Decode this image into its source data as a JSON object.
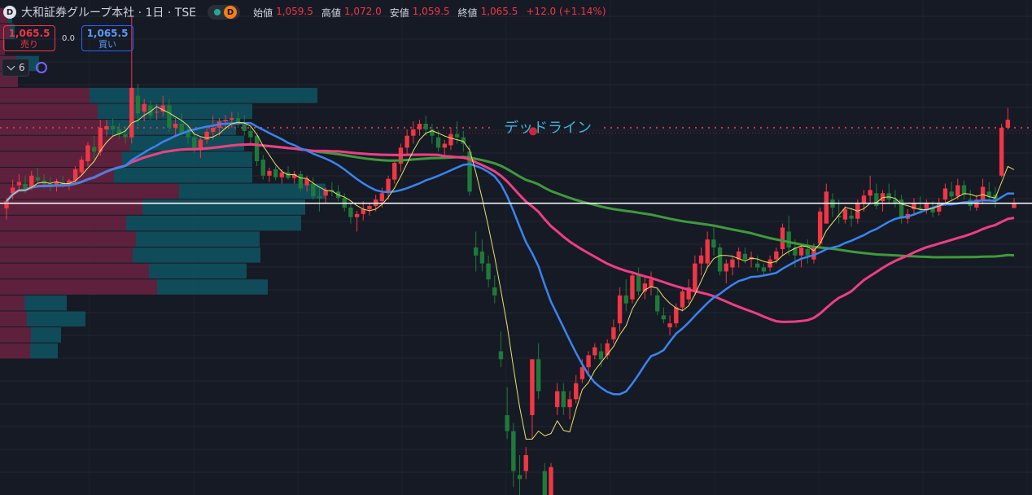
{
  "header": {
    "symbol_icon": "D",
    "title": "大和証券グループ本社 · 1日 · TSE",
    "data_badge": "D",
    "ohlc": {
      "open_label": "始値",
      "open": "1,059.5",
      "high_label": "高値",
      "high": "1,072.0",
      "low_label": "安値",
      "low": "1,059.5",
      "close_label": "終値",
      "close": "1,065.5",
      "change": "+12.0 (+1.14%)"
    }
  },
  "trade": {
    "sell_price": "1,065.5",
    "sell_label": "売り",
    "spread": "0.0",
    "buy_price": "1,065.5",
    "buy_label": "買い"
  },
  "indicators": {
    "count": "6",
    "toggle_icon": "chevron-down-icon",
    "sync_icon": "sync-icon"
  },
  "colors": {
    "background": "#161a25",
    "up": "#f23645",
    "down": "#1f7a3a",
    "ma_fast": "#e8e36a",
    "ma_mid": "#3a84f0",
    "ma_slow": "#ee3e84",
    "ma_long": "#3f9a3a",
    "vp_pink": "#6a2342",
    "vp_teal": "#0f5563",
    "price_line": "#ffffff"
  },
  "chart_data": {
    "type": "candlestick",
    "annotation": {
      "text": "デッドライン",
      "price": 1160
    },
    "ylim": [
      700,
      1320
    ],
    "current_price": 1065.5,
    "grid": true,
    "ohlc": [
      [
        1059,
        1072,
        1045,
        1068
      ],
      [
        1078,
        1095,
        1070,
        1085
      ],
      [
        1088,
        1102,
        1080,
        1092
      ],
      [
        1090,
        1100,
        1078,
        1082
      ],
      [
        1084,
        1106,
        1082,
        1100
      ],
      [
        1098,
        1110,
        1090,
        1094
      ],
      [
        1094,
        1102,
        1084,
        1090
      ],
      [
        1090,
        1098,
        1080,
        1086
      ],
      [
        1086,
        1096,
        1080,
        1092
      ],
      [
        1092,
        1100,
        1085,
        1088
      ],
      [
        1088,
        1096,
        1082,
        1094
      ],
      [
        1094,
        1112,
        1090,
        1108
      ],
      [
        1104,
        1124,
        1100,
        1120
      ],
      [
        1118,
        1142,
        1112,
        1138
      ],
      [
        1136,
        1150,
        1120,
        1130
      ],
      [
        1130,
        1170,
        1125,
        1160
      ],
      [
        1158,
        1170,
        1150,
        1162
      ],
      [
        1162,
        1172,
        1150,
        1158
      ],
      [
        1158,
        1166,
        1146,
        1152
      ],
      [
        1152,
        1162,
        1140,
        1148
      ],
      [
        1148,
        1300,
        1140,
        1210
      ],
      [
        1200,
        1215,
        1162,
        1178
      ],
      [
        1180,
        1196,
        1168,
        1190
      ],
      [
        1188,
        1194,
        1170,
        1175
      ],
      [
        1180,
        1190,
        1170,
        1180
      ],
      [
        1180,
        1200,
        1174,
        1188
      ],
      [
        1188,
        1196,
        1155,
        1160
      ],
      [
        1160,
        1172,
        1148,
        1165
      ],
      [
        1165,
        1178,
        1150,
        1152
      ],
      [
        1155,
        1162,
        1140,
        1148
      ],
      [
        1148,
        1158,
        1128,
        1135
      ],
      [
        1135,
        1148,
        1122,
        1145
      ],
      [
        1145,
        1162,
        1140,
        1155
      ],
      [
        1155,
        1175,
        1145,
        1160
      ],
      [
        1160,
        1172,
        1150,
        1168
      ],
      [
        1168,
        1176,
        1158,
        1170
      ],
      [
        1170,
        1180,
        1160,
        1172
      ],
      [
        1172,
        1180,
        1160,
        1164
      ],
      [
        1164,
        1176,
        1150,
        1156
      ],
      [
        1156,
        1164,
        1140,
        1148
      ],
      [
        1150,
        1152,
        1112,
        1118
      ],
      [
        1120,
        1126,
        1095,
        1100
      ],
      [
        1100,
        1110,
        1092,
        1106
      ],
      [
        1108,
        1112,
        1094,
        1098
      ],
      [
        1098,
        1108,
        1090,
        1104
      ],
      [
        1104,
        1112,
        1095,
        1097
      ],
      [
        1097,
        1106,
        1090,
        1102
      ],
      [
        1102,
        1106,
        1080,
        1084
      ],
      [
        1088,
        1100,
        1080,
        1096
      ],
      [
        1090,
        1098,
        1070,
        1074
      ],
      [
        1074,
        1084,
        1055,
        1072
      ],
      [
        1075,
        1085,
        1065,
        1082
      ],
      [
        1082,
        1092,
        1074,
        1080
      ],
      [
        1080,
        1088,
        1068,
        1072
      ],
      [
        1072,
        1078,
        1055,
        1060
      ],
      [
        1060,
        1065,
        1040,
        1048
      ],
      [
        1048,
        1056,
        1030,
        1052
      ],
      [
        1052,
        1068,
        1044,
        1058
      ],
      [
        1058,
        1066,
        1050,
        1062
      ],
      [
        1062,
        1076,
        1055,
        1070
      ],
      [
        1068,
        1085,
        1060,
        1078
      ],
      [
        1078,
        1100,
        1070,
        1096
      ],
      [
        1095,
        1120,
        1090,
        1116
      ],
      [
        1115,
        1140,
        1105,
        1135
      ],
      [
        1135,
        1158,
        1125,
        1150
      ],
      [
        1150,
        1168,
        1140,
        1158
      ],
      [
        1158,
        1170,
        1150,
        1165
      ],
      [
        1165,
        1175,
        1150,
        1158
      ],
      [
        1158,
        1165,
        1140,
        1150
      ],
      [
        1148,
        1156,
        1130,
        1135
      ],
      [
        1135,
        1145,
        1122,
        1140
      ],
      [
        1138,
        1160,
        1132,
        1152
      ],
      [
        1152,
        1168,
        1140,
        1148
      ],
      [
        1148,
        1156,
        1130,
        1140
      ],
      [
        1130,
        1138,
        1075,
        1080
      ],
      [
        1010,
        1030,
        980,
        1000
      ],
      [
        1005,
        1020,
        980,
        990
      ],
      [
        990,
        1000,
        960,
        970
      ],
      [
        960,
        975,
        940,
        950
      ],
      [
        880,
        905,
        860,
        870
      ],
      [
        800,
        835,
        770,
        780
      ],
      [
        780,
        790,
        710,
        730
      ],
      [
        725,
        750,
        700,
        720
      ],
      [
        730,
        760,
        720,
        750
      ],
      [
        800,
        850,
        770,
        870
      ],
      [
        870,
        890,
        820,
        830
      ],
      [
        730,
        740,
        695,
        700
      ],
      [
        700,
        740,
        690,
        735
      ],
      [
        810,
        840,
        800,
        830
      ],
      [
        830,
        840,
        800,
        810
      ],
      [
        810,
        830,
        795,
        820
      ],
      [
        820,
        850,
        815,
        840
      ],
      [
        845,
        870,
        840,
        860
      ],
      [
        860,
        880,
        850,
        875
      ],
      [
        875,
        890,
        870,
        885
      ],
      [
        880,
        890,
        860,
        870
      ],
      [
        875,
        895,
        870,
        890
      ],
      [
        895,
        920,
        890,
        910
      ],
      [
        915,
        960,
        905,
        950
      ],
      [
        950,
        970,
        930,
        940
      ],
      [
        945,
        980,
        940,
        975
      ],
      [
        975,
        985,
        950,
        955
      ],
      [
        955,
        975,
        945,
        965
      ],
      [
        960,
        980,
        950,
        970
      ],
      [
        950,
        960,
        925,
        930
      ],
      [
        925,
        935,
        915,
        920
      ],
      [
        910,
        925,
        900,
        915
      ],
      [
        915,
        940,
        910,
        935
      ],
      [
        935,
        960,
        930,
        955
      ],
      [
        945,
        970,
        940,
        960
      ],
      [
        955,
        1000,
        950,
        990
      ],
      [
        990,
        1010,
        975,
        1000
      ],
      [
        990,
        1030,
        985,
        1020
      ],
      [
        1020,
        1035,
        1000,
        1010
      ],
      [
        1010,
        1015,
        975,
        980
      ],
      [
        980,
        995,
        965,
        990
      ],
      [
        985,
        1000,
        975,
        995
      ],
      [
        995,
        1010,
        985,
        1005
      ],
      [
        1002,
        1010,
        990,
        995
      ],
      [
        995,
        1005,
        985,
        998
      ],
      [
        990,
        1000,
        980,
        985
      ],
      [
        985,
        990,
        975,
        980
      ],
      [
        985,
        1000,
        980,
        995
      ],
      [
        995,
        1010,
        990,
        1005
      ],
      [
        1008,
        1040,
        1000,
        1035
      ],
      [
        1030,
        1050,
        1000,
        1010
      ],
      [
        1010,
        1020,
        985,
        1000
      ],
      [
        1000,
        1015,
        985,
        1010
      ],
      [
        1008,
        1020,
        990,
        1000
      ],
      [
        995,
        1015,
        990,
        1010
      ],
      [
        1015,
        1060,
        1010,
        1055
      ],
      [
        1040,
        1090,
        1040,
        1080
      ],
      [
        1070,
        1078,
        1048,
        1060
      ],
      [
        1050,
        1070,
        1040,
        1048
      ],
      [
        1045,
        1062,
        1040,
        1058
      ],
      [
        1050,
        1060,
        1036,
        1046
      ],
      [
        1046,
        1070,
        1040,
        1066
      ],
      [
        1066,
        1082,
        1055,
        1075
      ],
      [
        1075,
        1100,
        1065,
        1082
      ],
      [
        1078,
        1090,
        1058,
        1062
      ],
      [
        1068,
        1082,
        1055,
        1078
      ],
      [
        1078,
        1090,
        1066,
        1070
      ],
      [
        1070,
        1082,
        1060,
        1066
      ],
      [
        1070,
        1076,
        1040,
        1046
      ],
      [
        1046,
        1058,
        1040,
        1052
      ],
      [
        1058,
        1072,
        1050,
        1065
      ],
      [
        1060,
        1074,
        1052,
        1058
      ],
      [
        1058,
        1070,
        1052,
        1066
      ],
      [
        1060,
        1068,
        1048,
        1054
      ],
      [
        1055,
        1072,
        1050,
        1066
      ],
      [
        1070,
        1090,
        1062,
        1084
      ],
      [
        1080,
        1092,
        1068,
        1074
      ],
      [
        1074,
        1096,
        1070,
        1088
      ],
      [
        1088,
        1094,
        1070,
        1076
      ],
      [
        1070,
        1082,
        1056,
        1062
      ],
      [
        1060,
        1076,
        1056,
        1070
      ],
      [
        1068,
        1096,
        1064,
        1086
      ],
      [
        1080,
        1092,
        1070,
        1074
      ],
      [
        1076,
        1086,
        1060,
        1068
      ],
      [
        1100,
        1165,
        1098,
        1160
      ],
      [
        1160,
        1185,
        1158,
        1170
      ],
      [
        1059.5,
        1072,
        1059.5,
        1065.5
      ]
    ],
    "volume_profile": [
      [
        1300,
        10,
        5
      ],
      [
        1280,
        12,
        6
      ],
      [
        1260,
        6,
        0
      ],
      [
        1240,
        20,
        28
      ],
      [
        1220,
        22,
        0
      ],
      [
        1200,
        110,
        280
      ],
      [
        1180,
        120,
        190
      ],
      [
        1160,
        130,
        160
      ],
      [
        1140,
        160,
        140
      ],
      [
        1120,
        150,
        160
      ],
      [
        1100,
        140,
        170
      ],
      [
        1080,
        220,
        180
      ],
      [
        1060,
        175,
        200
      ],
      [
        1040,
        155,
        215
      ],
      [
        1020,
        167,
        152
      ],
      [
        1000,
        163,
        157
      ],
      [
        980,
        183,
        120
      ],
      [
        960,
        193,
        136
      ],
      [
        940,
        30,
        52
      ],
      [
        920,
        33,
        72
      ],
      [
        900,
        38,
        37
      ],
      [
        880,
        37,
        34
      ],
      [
        860,
        0,
        0
      ]
    ],
    "ma_fast_period": 5,
    "ma_mid_period": 20,
    "ma_slow_period": 50,
    "ma_long_period": 100
  }
}
